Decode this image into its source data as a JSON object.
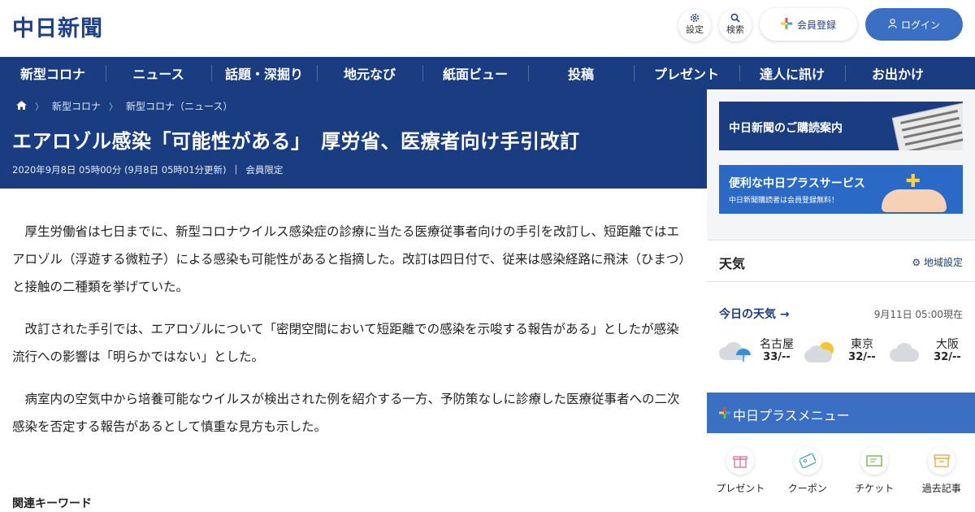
{
  "header": {
    "logo": "中日新聞",
    "settings_label": "設定",
    "search_label": "検索",
    "register_label": "会員登録",
    "login_label": "ログイン"
  },
  "nav": {
    "items": [
      "新型コロナ",
      "ニュース",
      "話題・深掘り",
      "地元なび",
      "紙面ビュー",
      "投稿",
      "プレゼント",
      "達人に訊け",
      "お出かけ"
    ]
  },
  "breadcrumb": {
    "items": [
      "新型コロナ",
      "新型コロナ（ニュース）"
    ]
  },
  "article": {
    "headline": "エアロゾル感染「可能性がある」　厚労省、医療者向け手引改訂",
    "date": "2020年9月8日 05時00分 (9月8日 05時01分更新)",
    "divider": "|",
    "member_only": "会員限定",
    "paragraphs": [
      "厚生労働省は七日までに、新型コロナウイルス感染症の診療に当たる医療従事者向けの手引を改訂し、短距離ではエアロゾル（浮遊する微粒子）による感染も可能性があると指摘した。改訂は四日付で、従来は感染経路に飛沫（ひまつ）と接触の二種類を挙げていた。",
      "改訂された手引では、エアロゾルについて「密閉空間において短距離での感染を示唆する報告がある」としたが感染流行への影響は「明らかではない」とした。",
      "病室内の空気中から培養可能なウイルスが検出された例を紹介する一方、予防策なしに診療した医療従事者への二次感染を否定する報告があるとして慎重な見方も示した。"
    ],
    "keywords_heading": "関連キーワード"
  },
  "sidebar": {
    "banner1": "中日新聞のご購読案内",
    "banner2_title": "便利な中日プラスサービス",
    "banner2_sub": "中日新聞購読者は会員登録無料！",
    "weather": {
      "title": "天気",
      "region_setting": "地域設定",
      "today": "今日の天気",
      "time": "9月11日 05:00現在",
      "cities": [
        {
          "name": "名古屋",
          "temp": "33/--",
          "icon": "cloud-umbrella-icon"
        },
        {
          "name": "東京",
          "temp": "32/--",
          "icon": "sun-cloud-icon"
        },
        {
          "name": "大阪",
          "temp": "32/--",
          "icon": "cloud-icon"
        }
      ]
    },
    "plus_menu": {
      "title": "中日プラスメニュー",
      "items": [
        {
          "label": "プレゼント",
          "icon": "gift-icon",
          "color": "#e56b93"
        },
        {
          "label": "クーポン",
          "icon": "coupon-icon",
          "color": "#3ea3b0"
        },
        {
          "label": "チケット",
          "icon": "ticket-icon",
          "color": "#6aae4c"
        },
        {
          "label": "過去記事",
          "icon": "archive-box-icon",
          "color": "#e8a838"
        }
      ]
    }
  },
  "colors": {
    "brand_navy": "#1a3d82",
    "accent_blue": "#3b6fc3"
  }
}
